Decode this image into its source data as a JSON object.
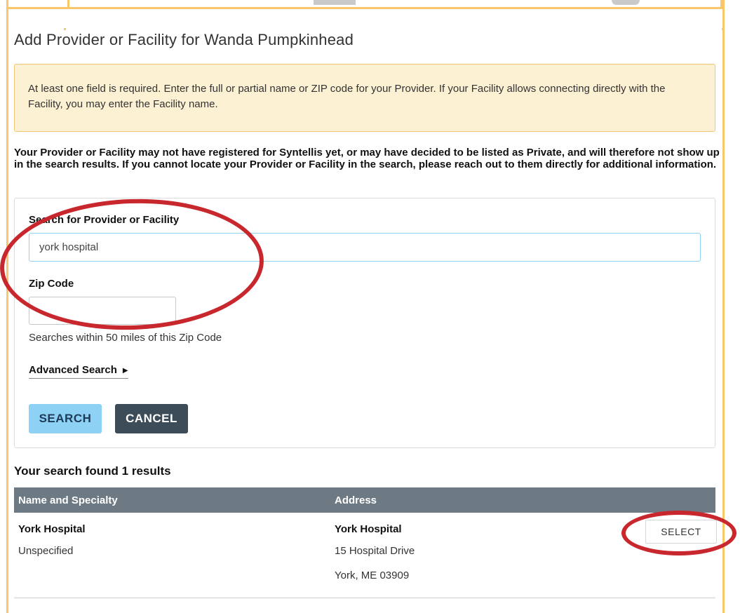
{
  "dialog": {
    "title": "Add Provider or Facility for Wanda Pumpkinhead",
    "alert_text": "At least one field is required. Enter the full or partial name or ZIP code for your Provider. If your Facility allows connecting directly with the Facility, you may enter the Facility name.",
    "notice_text": "Your Provider or Facility may not have registered for Syntellis yet, or may have decided to be listed as Private, and will therefore not show up in the search results. If you cannot locate your Provider or Facility in the search, please reach out to them directly for additional information."
  },
  "search_form": {
    "provider_label": "Search for Provider or Facility",
    "provider_value": "york hospital",
    "zip_label": "Zip Code",
    "zip_value": "",
    "zip_helper": "Searches within 50 miles of this Zip Code",
    "advanced_label": "Advanced Search",
    "search_button": "SEARCH",
    "cancel_button": "CANCEL"
  },
  "results": {
    "summary": "Your search found 1 results",
    "columns": [
      "Name and Specialty",
      "Address"
    ],
    "rows": [
      {
        "name": "York Hospital",
        "specialty": "Unspecified",
        "address_name": "York Hospital",
        "address_line1": "15 Hospital Drive",
        "address_line2": "York, ME 03909",
        "action": "SELECT"
      }
    ]
  },
  "colors": {
    "frame": "#f7c76a",
    "alert_bg": "#fdf1d3",
    "search_button": "#8dd1f5",
    "cancel_button": "#3c4c58",
    "table_header": "#6d7a84",
    "annotation": "#c8282d"
  }
}
